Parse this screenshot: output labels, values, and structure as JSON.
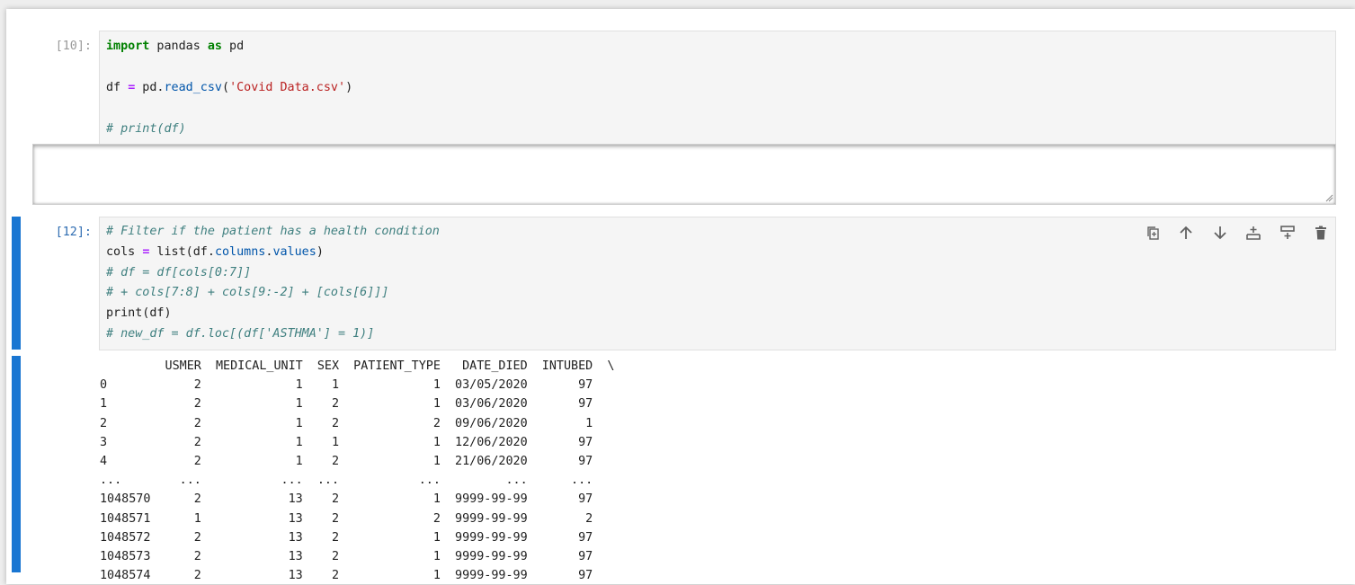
{
  "cells": [
    {
      "prompt": "[10]:",
      "lines": [
        [
          {
            "t": "kw",
            "v": "import"
          },
          {
            "t": "",
            "v": " pandas "
          },
          {
            "t": "kw",
            "v": "as"
          },
          {
            "t": "",
            "v": " pd"
          }
        ],
        [],
        [
          {
            "t": "",
            "v": "df "
          },
          {
            "t": "op",
            "v": "="
          },
          {
            "t": "",
            "v": " pd."
          },
          {
            "t": "attr",
            "v": "read_csv"
          },
          {
            "t": "",
            "v": "("
          },
          {
            "t": "str",
            "v": "'Covid Data.csv'"
          },
          {
            "t": "",
            "v": ")"
          }
        ],
        [],
        [
          {
            "t": "cm",
            "v": "# print(df)"
          }
        ]
      ]
    },
    {
      "prompt": "[12]:",
      "lines": [
        [
          {
            "t": "cm",
            "v": "# Filter if the patient has a health condition"
          }
        ],
        [
          {
            "t": "",
            "v": "cols "
          },
          {
            "t": "op",
            "v": "="
          },
          {
            "t": "",
            "v": " list(df."
          },
          {
            "t": "attr",
            "v": "columns"
          },
          {
            "t": "",
            "v": "."
          },
          {
            "t": "attr",
            "v": "values"
          },
          {
            "t": "",
            "v": ")"
          }
        ],
        [
          {
            "t": "cm",
            "v": "# df = df[cols[0:7]]"
          }
        ],
        [
          {
            "t": "cm",
            "v": "# + cols[7:8] + cols[9:-2] + [cols[6]]]"
          }
        ],
        [
          {
            "t": "",
            "v": "print(df)"
          }
        ],
        [
          {
            "t": "cm",
            "v": "# new_df = df.loc[(df['ASTHMA'] = 1)]"
          }
        ]
      ]
    }
  ],
  "toolbar": [
    {
      "name": "duplicate-cell-icon",
      "title": "Create a duplicate of this cell below"
    },
    {
      "name": "move-up-icon",
      "title": "Move this cell up"
    },
    {
      "name": "move-down-icon",
      "title": "Move this cell down"
    },
    {
      "name": "insert-above-icon",
      "title": "Insert a cell above"
    },
    {
      "name": "insert-below-icon",
      "title": "Insert a cell below"
    },
    {
      "name": "delete-cell-icon",
      "title": "Delete this cell"
    }
  ],
  "output_lines": [
    "         USMER  MEDICAL_UNIT  SEX  PATIENT_TYPE   DATE_DIED  INTUBED  \\",
    "0            2             1    1             1  03/05/2020       97   ",
    "1            2             1    2             1  03/06/2020       97   ",
    "2            2             1    2             2  09/06/2020        1   ",
    "3            2             1    1             1  12/06/2020       97   ",
    "4            2             1    2             1  21/06/2020       97   ",
    "...        ...           ...  ...           ...         ...      ...   ",
    "1048570      2            13    2             1  9999-99-99       97   ",
    "1048571      1            13    2             2  9999-99-99        2   ",
    "1048572      2            13    2             1  9999-99-99       97   ",
    "1048573      2            13    2             1  9999-99-99       97   ",
    "1048574      2            13    2             1  9999-99-99       97   "
  ],
  "colors": {
    "accent": "#1976d2",
    "prompt": "#9a9a9a",
    "active_prompt": "#2f6db2"
  }
}
